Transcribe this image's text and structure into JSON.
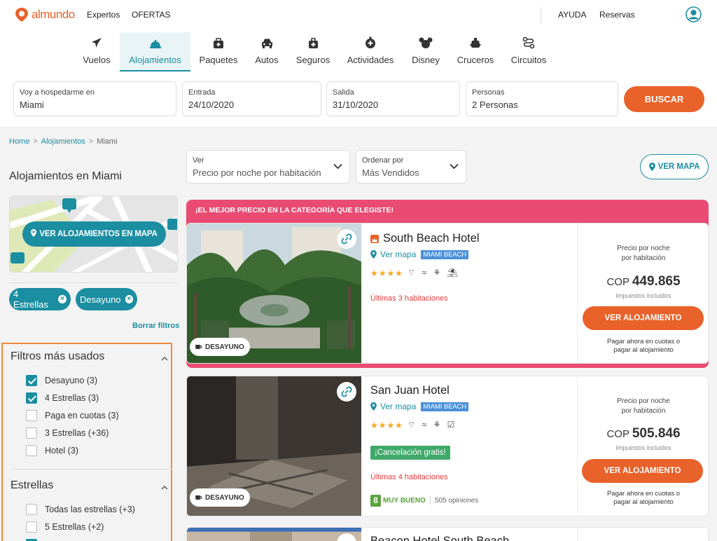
{
  "topbar": {
    "logo": "almundo",
    "nav_left": [
      "Expertos",
      "OFERTAS"
    ],
    "nav_right": [
      "AYUDA",
      "Reservas"
    ]
  },
  "product_tabs": [
    {
      "label": "Vuelos",
      "icon": "plane-icon"
    },
    {
      "label": "Alojamientos",
      "icon": "bell-icon",
      "active": true
    },
    {
      "label": "Paquetes",
      "icon": "suitcase-icon"
    },
    {
      "label": "Autos",
      "icon": "car-icon"
    },
    {
      "label": "Seguros",
      "icon": "medical-case-icon"
    },
    {
      "label": "Actividades",
      "icon": "activity-icon"
    },
    {
      "label": "Disney",
      "icon": "mickey-icon"
    },
    {
      "label": "Cruceros",
      "icon": "ship-icon"
    },
    {
      "label": "Circuitos",
      "icon": "route-icon"
    }
  ],
  "search": {
    "destination_label": "Voy a hospedarme en",
    "destination_value": "Miami",
    "checkin_label": "Entrada",
    "checkin_value": "24/10/2020",
    "checkout_label": "Salida",
    "checkout_value": "31/10/2020",
    "guests_label": "Personas",
    "guests_value": "2 Personas",
    "button": "BUSCAR"
  },
  "breadcrumb": {
    "items": [
      "Home",
      "Alojamientos",
      "Miami"
    ],
    "separator": ">"
  },
  "sidebar": {
    "title": "Alojamientos en Miami",
    "map_button": "VER ALOJAMIENTOS EN MAPA",
    "chips": [
      "4 Estrellas",
      "Desayuno"
    ],
    "clear_filters": "Borrar filtros",
    "sections": [
      {
        "title": "Filtros más usados",
        "items": [
          {
            "label": "Desayuno (3)",
            "checked": true
          },
          {
            "label": "4 Estrellas (3)",
            "checked": true
          },
          {
            "label": "Paga en cuotas (3)",
            "checked": false
          },
          {
            "label": "3 Estrellas (+36)",
            "checked": false
          },
          {
            "label": "Hotel (3)",
            "checked": false
          }
        ]
      },
      {
        "title": "Estrellas",
        "items": [
          {
            "label": "Todas las estrellas (+3)",
            "checked": false
          },
          {
            "label": "5 Estrellas (+2)",
            "checked": false
          }
        ]
      }
    ]
  },
  "controls": {
    "view_label": "Ver",
    "view_value": "Precio por noche por habitación",
    "sort_label": "Ordenar por",
    "sort_value": "Más Vendidos",
    "map_button": "VER MAPA"
  },
  "promo_banner": "¡EL MEJOR PRECIO EN LA CATEGORÍA QUE ELEGISTE!",
  "hotels": [
    {
      "name": "South Beach Hotel",
      "map_link": "Ver mapa",
      "area": "MIAMI BEACH",
      "stars": "★★★★",
      "amenities": "wifi pool spa beach",
      "availability": "Últimas 3 habitaciones",
      "tag": "DESAYUNO",
      "price_label_1": "Precio por noche",
      "price_label_2": "por habitación",
      "currency": "COP",
      "price": "449.865",
      "tax": "Impuestos incluidos",
      "button": "VER ALOJAMIENTO",
      "pay_1": "Pagar ahora en cuotas o",
      "pay_2": "pagar al alojamiento"
    },
    {
      "name": "San Juan Hotel",
      "map_link": "Ver mapa",
      "area": "MIAMI BEACH",
      "stars": "★★★★",
      "amenities": "wifi pool beach check",
      "cancellation": "¡Cancelación gratis!",
      "availability": "Últimas 4 habitaciones",
      "rating_score": "8",
      "rating_text": "MUY BUENO",
      "reviews": "505 opiniones",
      "tag": "DESAYUNO",
      "price_label_1": "Precio por noche",
      "price_label_2": "por habitación",
      "currency": "COP",
      "price": "505.846",
      "tax": "Impuestos incluidos",
      "button": "VER ALOJAMIENTO",
      "pay_1": "Pagar ahora en cuotas o",
      "pay_2": "pagar al alojamiento"
    },
    {
      "name": "Beacon Hotel South Beach"
    }
  ],
  "colors": {
    "brand_orange": "#e8622a",
    "teal": "#1b8ea1",
    "promo_pink": "#e94b72",
    "star": "#f5a623",
    "urgent_red": "#e83c3c",
    "green": "#3fa96a"
  }
}
